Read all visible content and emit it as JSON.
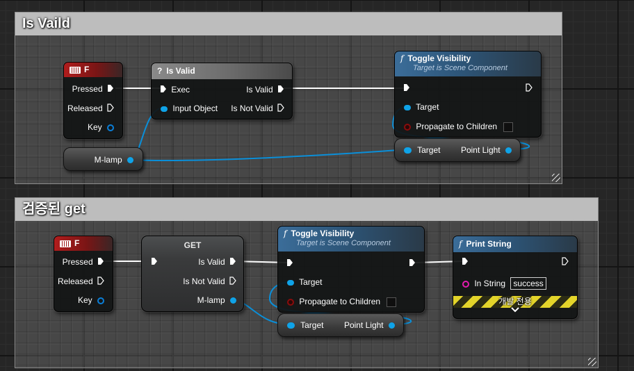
{
  "comments": [
    {
      "title": "Is Vaild"
    },
    {
      "title": "검증된 get"
    }
  ],
  "graph1": {
    "event": {
      "title": "F",
      "pins": {
        "pressed": "Pressed",
        "released": "Released",
        "key": "Key"
      }
    },
    "is_valid": {
      "title": "Is Valid",
      "pins": {
        "exec": "Exec",
        "input_object": "Input Object",
        "is_valid": "Is Valid",
        "is_not_valid": "Is Not Valid"
      }
    },
    "toggle": {
      "title": "Toggle Visibility",
      "subtitle": "Target is Scene Component",
      "pins": {
        "target": "Target",
        "propagate": "Propagate to Children"
      }
    },
    "get_light": {
      "target": "Target",
      "point_light": "Point Light"
    },
    "var": {
      "label": "M-lamp"
    }
  },
  "graph2": {
    "event": {
      "title": "F",
      "pins": {
        "pressed": "Pressed",
        "released": "Released",
        "key": "Key"
      }
    },
    "get": {
      "title": "GET",
      "pins": {
        "is_valid": "Is Valid",
        "is_not_valid": "Is Not Valid",
        "m_lamp": "M-lamp"
      }
    },
    "toggle": {
      "title": "Toggle Visibility",
      "subtitle": "Target is Scene Component",
      "pins": {
        "target": "Target",
        "propagate": "Propagate to Children"
      }
    },
    "get_light": {
      "target": "Target",
      "point_light": "Point Light"
    },
    "print": {
      "title": "Print String",
      "in_string_label": "In String",
      "in_string_value": "success",
      "dev_only": "개발 전용"
    }
  },
  "colors": {
    "exec_wire": "#ffffff",
    "object_wire": "#0a8fd9",
    "event_header": "#b11d1d",
    "function_header": "#3b6d99"
  },
  "icons": [
    "keyboard-icon",
    "question-icon",
    "function-icon",
    "exec-pin-icon",
    "object-pin-icon",
    "chevron-down-icon",
    "resize-grip-icon"
  ]
}
